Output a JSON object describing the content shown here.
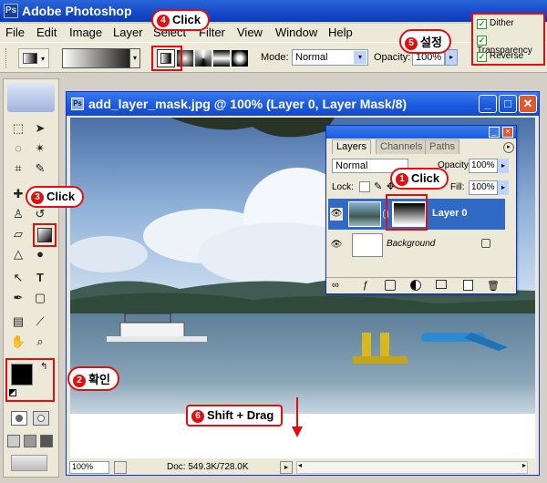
{
  "app": {
    "title": "Adobe Photoshop"
  },
  "menu": {
    "items": [
      "File",
      "Edit",
      "Image",
      "Layer",
      "Select",
      "Filter",
      "View",
      "Window",
      "Help"
    ]
  },
  "options": {
    "mode_label": "Mode:",
    "mode_value": "Normal",
    "opacity_label": "Opacity:",
    "opacity_value": "100%",
    "dither": "Dither",
    "transparency": "Transparency",
    "reverse": "Reverse"
  },
  "document": {
    "title": "add_layer_mask.jpg @ 100% (Layer 0, Layer Mask/8)",
    "zoom": "100%",
    "doc_size": "Doc: 549.3K/728.0K"
  },
  "layers_panel": {
    "tabs": [
      "Layers",
      "Channels",
      "Paths"
    ],
    "blend_mode": "Normal",
    "opacity_label": "Opacity:",
    "opacity_value": "100%",
    "lock_label": "Lock:",
    "fill_label": "Fill:",
    "fill_value": "100%",
    "layers": [
      {
        "name": "Layer 0",
        "selected": true
      },
      {
        "name": "Background",
        "selected": false
      }
    ]
  },
  "annotations": {
    "step1": {
      "num": "1",
      "text": "Click"
    },
    "step2": {
      "num": "2",
      "text": "확인"
    },
    "step3": {
      "num": "3",
      "text": "Click"
    },
    "step4": {
      "num": "4",
      "text": "Click"
    },
    "step5": {
      "num": "5",
      "text": "설정"
    },
    "step6": {
      "num": "6",
      "text": "Shift + Drag"
    }
  },
  "colors": {
    "accent_red": "#e01010",
    "titlebar_blue": "#1d5ae0",
    "selection_blue": "#316ac5"
  }
}
